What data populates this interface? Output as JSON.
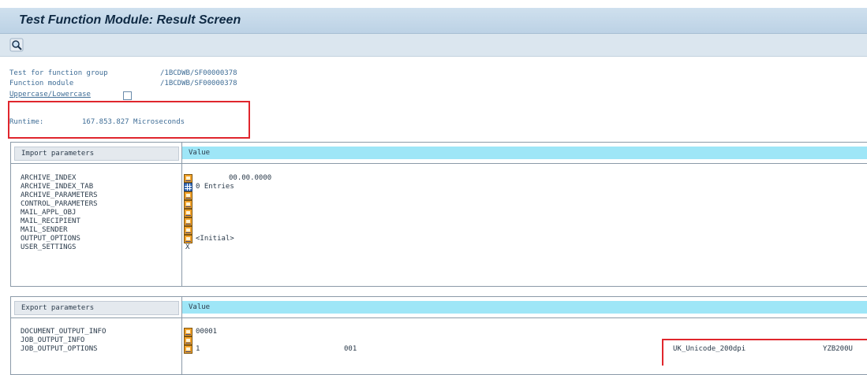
{
  "title": "Test Function Module: Result Screen",
  "toolbar": {
    "buttons": [
      {
        "icon": "search-icon"
      }
    ]
  },
  "info": {
    "function_group_label": "Test for function group",
    "function_group_value": "/1BCDWB/SF00000378",
    "function_module_label": "Function module",
    "function_module_value": "/1BCDWB/SF00000378",
    "case_label": "Uppercase/Lowercase",
    "case_checked": false,
    "runtime_label": "Runtime:",
    "runtime_value": "167.853.827 Microseconds"
  },
  "import_table": {
    "header_param": "Import parameters",
    "header_value": "Value",
    "rows": [
      {
        "name": "ARCHIVE_INDEX",
        "icon": "edit-icon",
        "value": "00.00.0000"
      },
      {
        "name": "ARCHIVE_INDEX_TAB",
        "icon": "table-icon",
        "value": "0 Entries"
      },
      {
        "name": "ARCHIVE_PARAMETERS",
        "icon": "edit-icon",
        "value": ""
      },
      {
        "name": "CONTROL_PARAMETERS",
        "icon": "edit-icon",
        "value": ""
      },
      {
        "name": "MAIL_APPL_OBJ",
        "icon": "edit-icon",
        "value": ""
      },
      {
        "name": "MAIL_RECIPIENT",
        "icon": "edit-icon",
        "value": ""
      },
      {
        "name": "MAIL_SENDER",
        "icon": "edit-icon",
        "value": ""
      },
      {
        "name": "OUTPUT_OPTIONS",
        "icon": "edit-icon",
        "value": "<Initial>"
      },
      {
        "name": "USER_SETTINGS",
        "icon": "",
        "value": "X"
      }
    ]
  },
  "export_table": {
    "header_param": "Export parameters",
    "header_value": "Value",
    "rows": [
      {
        "name": "DOCUMENT_OUTPUT_INFO",
        "icon": "edit-icon",
        "value": "00001"
      },
      {
        "name": "JOB_OUTPUT_INFO",
        "icon": "edit-icon",
        "value": ""
      },
      {
        "name": "JOB_OUTPUT_OPTIONS",
        "icon": "edit-icon",
        "value": "1",
        "value2": "001",
        "value3": "UK_Unicode_200dpi",
        "value4": "YZB200U"
      }
    ]
  },
  "colors": {
    "highlight": "#e0262d",
    "header_accent": "#9ee6f7",
    "title_bg": "#c6d9e9"
  }
}
